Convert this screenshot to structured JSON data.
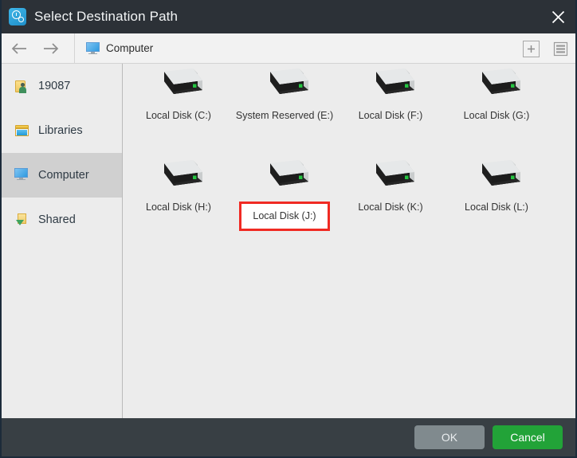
{
  "window": {
    "title": "Select Destination Path",
    "title_icon": "app-clock-gear-icon",
    "close_icon": "close-icon"
  },
  "toolbar": {
    "back_icon": "arrow-left-icon",
    "forward_icon": "arrow-right-icon",
    "breadcrumb": {
      "icon": "computer-monitor-icon",
      "label": "Computer"
    },
    "new_folder_icon": "plus-box-icon",
    "view_list_icon": "list-view-icon"
  },
  "sidebar": {
    "items": [
      {
        "label": "19087",
        "icon": "user-folder-icon",
        "selected": false
      },
      {
        "label": "Libraries",
        "icon": "libraries-icon",
        "selected": false
      },
      {
        "label": "Computer",
        "icon": "computer-monitor-icon",
        "selected": true
      },
      {
        "label": "Shared",
        "icon": "shared-folder-icon",
        "selected": false
      }
    ]
  },
  "main": {
    "drives": [
      {
        "label": "Local Disk (C:)",
        "icon": "hard-disk-icon",
        "highlighted": false
      },
      {
        "label": "System Reserved (E:)",
        "icon": "hard-disk-icon",
        "highlighted": false
      },
      {
        "label": "Local Disk (F:)",
        "icon": "hard-disk-icon",
        "highlighted": false
      },
      {
        "label": "Local Disk (G:)",
        "icon": "hard-disk-icon",
        "highlighted": false
      },
      {
        "label": "Local Disk (H:)",
        "icon": "hard-disk-icon",
        "highlighted": false
      },
      {
        "label": "Local Disk (J:)",
        "icon": "hard-disk-icon",
        "highlighted": true
      },
      {
        "label": "Local Disk (K:)",
        "icon": "hard-disk-icon",
        "highlighted": false
      },
      {
        "label": "Local Disk (L:)",
        "icon": "hard-disk-icon",
        "highlighted": false
      }
    ]
  },
  "footer": {
    "ok_label": "OK",
    "cancel_label": "Cancel"
  },
  "colors": {
    "titlebar": "#2c3137",
    "footer": "#383f44",
    "cancel_green": "#22a338",
    "ok_gray": "#808a8e",
    "highlight_red": "#f02a23",
    "selected_sidebar": "#d0d0d0",
    "content_bg": "#ececec"
  }
}
